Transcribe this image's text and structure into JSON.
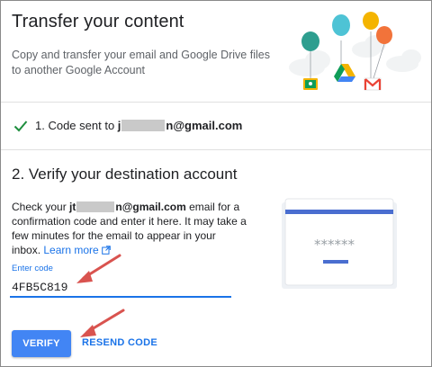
{
  "header": {
    "title": "Transfer your content",
    "subtitle": "Copy and transfer your email and Google Drive files to another Google Account"
  },
  "step1": {
    "prefix": "1. Code sent to ",
    "email_start": "j",
    "email_end": "n@gmail.com"
  },
  "step2": {
    "heading": "2. Verify your destination account",
    "desc_prefix": "Check your ",
    "email_start": "jt",
    "email_end": "n@gmail.com",
    "desc_middle": " email for a confirmation code and enter it here. It may take a few minutes for the email to appear in your inbox. ",
    "learn_more": "Learn more",
    "input_label": "Enter code",
    "input_value": "4FB5C819",
    "illustration_mask": "******"
  },
  "actions": {
    "verify_label": "VERIFY",
    "resend_label": "RESEND CODE"
  },
  "colors": {
    "accent": "#1a73e8",
    "button": "#4285f4",
    "check": "#1e8e3e",
    "arrow": "#d9534f"
  },
  "icons": [
    "check-icon",
    "external-link-icon",
    "google-classroom-icon",
    "google-drive-icon",
    "gmail-icon"
  ]
}
